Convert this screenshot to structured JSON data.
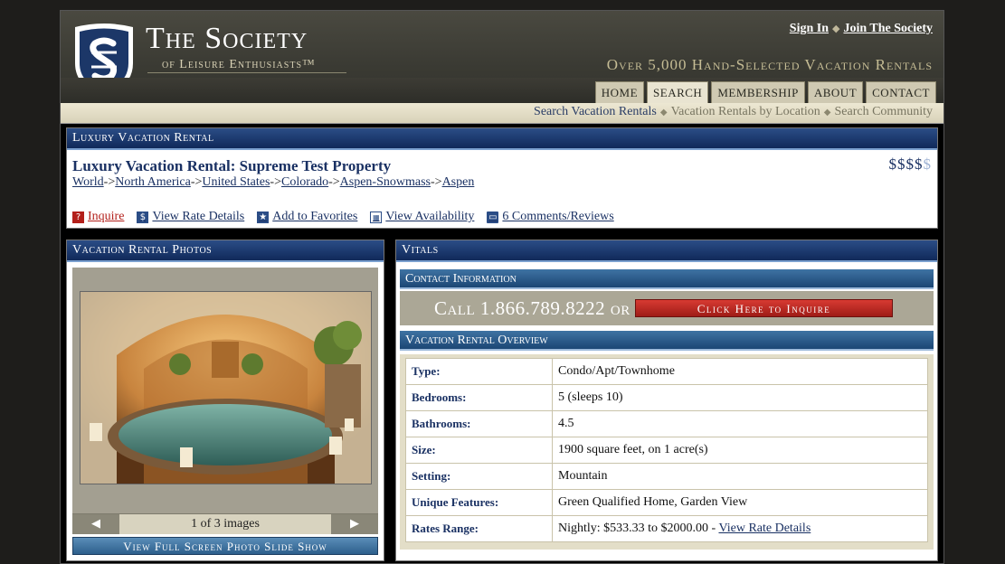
{
  "header": {
    "brand_title": "The Society",
    "brand_subtitle": "of Leisure Enthusiasts™",
    "tagline": "Over 5,000 Hand-Selected Vacation Rentals",
    "sign_in": "Sign In",
    "join": "Join The Society",
    "separator": "◆"
  },
  "nav": {
    "tabs": [
      "HOME",
      "SEARCH",
      "MEMBERSHIP",
      "ABOUT",
      "CONTACT"
    ],
    "active_tab": "SEARCH"
  },
  "subnav": {
    "search_rentals": "Search Vacation Rentals",
    "by_location": "Vacation Rentals by Location",
    "community": "Search Community"
  },
  "property": {
    "section_label": "Luxury Vacation Rental",
    "title": "Luxury Vacation Rental: Supreme Test Property",
    "price_symbols": "$$$$",
    "price_symbols_dim": "$",
    "breadcrumb": [
      "World",
      "North America",
      "United States",
      "Colorado",
      "Aspen-Snowmass",
      "Aspen"
    ],
    "breadcrumb_sep": "->",
    "actions": {
      "inquire": "Inquire",
      "rate_details": "View Rate Details",
      "favorites": "Add to Favorites",
      "availability": "View Availability",
      "comments": "6 Comments/Reviews"
    }
  },
  "photos": {
    "section_label": "Vacation Rental Photos",
    "pager_text": "1 of 3 images",
    "prev": "◀",
    "next": "▶",
    "slideshow": "View Full Screen Photo Slide Show"
  },
  "vitals": {
    "section_label": "Vitals",
    "contact_label": "Contact Information",
    "call_text": "Call 1.866.789.8222 or",
    "inquire_button": "Click Here to Inquire",
    "overview_label": "Vacation Rental Overview",
    "rows": [
      {
        "key": "Type:",
        "value": "Condo/Apt/Townhome"
      },
      {
        "key": "Bedrooms:",
        "value": "5 (sleeps 10)"
      },
      {
        "key": "Bathrooms:",
        "value": "4.5"
      },
      {
        "key": "Size:",
        "value": "1900 square feet, on 1 acre(s)"
      },
      {
        "key": "Setting:",
        "value": "Mountain"
      },
      {
        "key": "Unique Features:",
        "value": "Green Qualified Home, Garden View"
      },
      {
        "key": "Rates Range:",
        "value": "Nightly: $533.33 to $2000.00 - "
      }
    ],
    "rates_link": "View Rate Details"
  },
  "colors": {
    "navy": "#1a3163",
    "brand_bar": "#10295a",
    "inquire_red": "#b3201b"
  }
}
